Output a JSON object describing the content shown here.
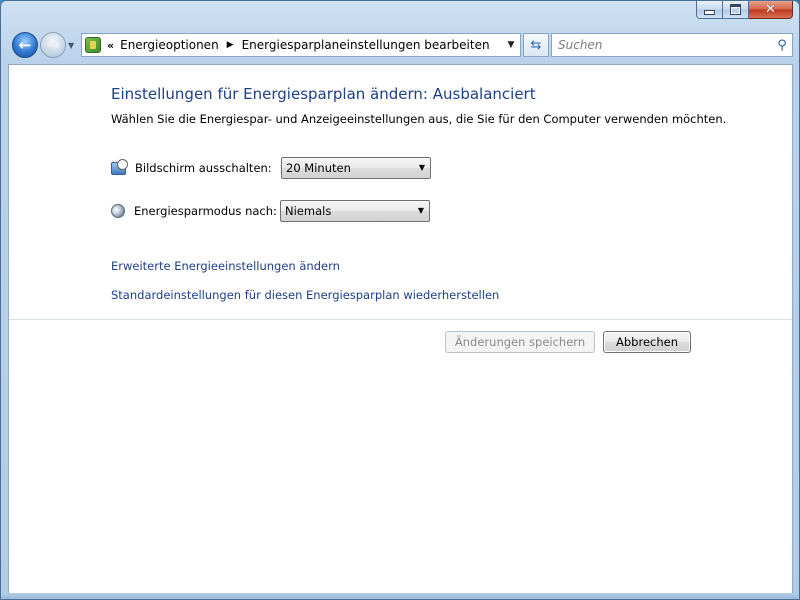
{
  "nav": {
    "breadcrumb_chevron": "«",
    "breadcrumb": [
      "Energieoptionen",
      "Energiesparplaneinstellungen bearbeiten"
    ],
    "search_placeholder": "Suchen"
  },
  "content": {
    "title": "Einstellungen für Energiesparplan ändern: Ausbalanciert",
    "subtitle": "Wählen Sie die Energiespar- und Anzeigeeinstellungen aus, die Sie für den Computer verwenden möchten.",
    "settings": [
      {
        "label": "Bildschirm ausschalten:",
        "value": "20 Minuten"
      },
      {
        "label": "Energiesparmodus nach:",
        "value": "Niemals"
      }
    ],
    "links": [
      "Erweiterte Energieeinstellungen ändern",
      "Standardeinstellungen für diesen Energiesparplan wiederherstellen"
    ],
    "buttons": {
      "save": "Änderungen speichern",
      "cancel": "Abbrechen"
    }
  },
  "colors": {
    "title_blue": "#1e3f8a",
    "link_blue": "#1e3f8a",
    "disabled_text": "#8b8b8b"
  }
}
